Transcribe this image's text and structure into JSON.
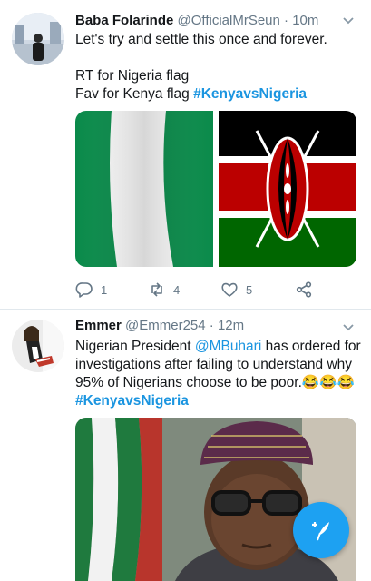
{
  "tweets": [
    {
      "name": "Baba Folarinde",
      "handle": "@OfficialMrSeun",
      "sep": "·",
      "time": "10m",
      "text_line1": "Let's try and settle this once and forever.",
      "text_line2": "RT for Nigeria flag",
      "text_line3": "Fav for Kenya flag ",
      "hashtag": "#KenyavsNigeria",
      "replies": "1",
      "retweets": "4",
      "likes": "5"
    },
    {
      "name": "Emmer",
      "handle": "@Emmer254",
      "sep": "·",
      "time": "12m",
      "text_line1_a": "Nigerian President ",
      "mention": "@MBuhari",
      "text_line1_b": " has ordered for",
      "text_line2": "investigations after failing to understand why",
      "text_line3": "95% of Nigerians choose to be poor.😂😂😂",
      "hashtag": "#KenyavsNigeria"
    }
  ],
  "icons": {
    "caret": "chevron-down-icon",
    "reply": "reply-icon",
    "retweet": "retweet-icon",
    "like": "heart-icon",
    "share": "share-icon",
    "compose": "compose-tweet-icon"
  },
  "colors": {
    "accent": "#1da1f2",
    "link": "#1b95e0",
    "meta": "#657786",
    "nigeria_green": "#008751",
    "kenya_red": "#bb0000",
    "kenya_green": "#006600"
  }
}
